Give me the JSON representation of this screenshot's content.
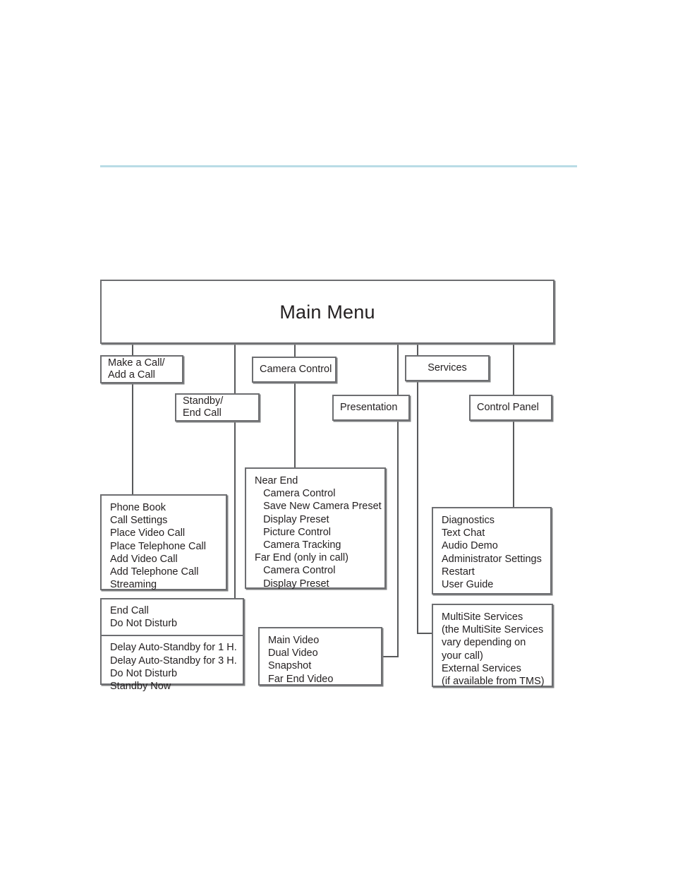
{
  "page": {
    "rule_color": "#b9dce6",
    "line_color": "#58595b",
    "box_border_color": "#6d6e71"
  },
  "diagram": {
    "type": "tree",
    "root": {
      "id": "main-menu",
      "label": "Main Menu"
    },
    "nodes": [
      {
        "id": "make-a-call",
        "label": "Make a Call/\nAdd a Call"
      },
      {
        "id": "standby-end-call",
        "label": "Standby/\nEnd Call"
      },
      {
        "id": "camera-control",
        "label": "Camera Control"
      },
      {
        "id": "services",
        "label": "Services"
      },
      {
        "id": "presentation",
        "label": "Presentation"
      },
      {
        "id": "control-panel",
        "label": "Control Panel"
      }
    ],
    "leaves": {
      "make_a_call_items": "Phone Book\nCall Settings\nPlace Video Call\nPlace Telephone Call\nAdd Video Call\nAdd Telephone Call\nStreaming",
      "end_call_top": "End Call\nDo Not Disturb",
      "end_call_bottom": "Delay Auto-Standby for 1 H.\nDelay Auto-Standby for 3 H.\nDo Not Disturb\nStandby Now",
      "camera_control_items": "Near End\n   Camera Control\n   Save New Camera Preset\n   Display Preset\n   Picture Control\n   Camera Tracking\nFar End (only in call)\n   Camera Control\n   Display Preset",
      "presentation_items": "Main Video\nDual Video\nSnapshot\nFar End Video",
      "control_panel_items": "Diagnostics\nText Chat\nAudio Demo\nAdministrator Settings\nRestart\nUser Guide",
      "services_items": "MultiSite Services\n(the MultiSite Services\nvary depending on\nyour call)\nExternal Services\n(if available from TMS)"
    }
  }
}
